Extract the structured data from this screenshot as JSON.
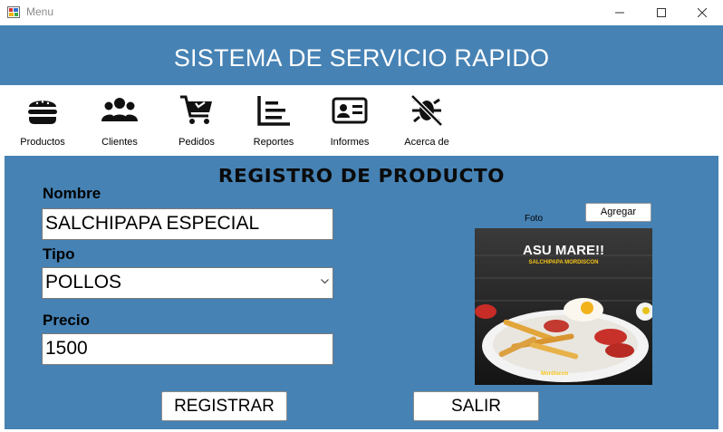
{
  "window": {
    "title": "Menu",
    "icons": [
      "app-icon",
      "minimize-icon",
      "maximize-icon",
      "close-icon"
    ]
  },
  "header": {
    "title": "SISTEMA DE SERVICIO RAPIDO",
    "background": "#4682b4"
  },
  "toolbar": {
    "items": [
      {
        "label": "Productos",
        "icon": "burger-icon"
      },
      {
        "label": "Clientes",
        "icon": "users-icon"
      },
      {
        "label": "Pedidos",
        "icon": "cart-icon"
      },
      {
        "label": "Reportes",
        "icon": "chart-icon"
      },
      {
        "label": "Informes",
        "icon": "id-card-icon"
      },
      {
        "label": "Acerca de",
        "icon": "bug-slash-icon"
      }
    ]
  },
  "form": {
    "title": "REGISTRO DE PRODUCTO",
    "nombre_label": "Nombre",
    "nombre_value": "SALCHIPAPA ESPECIAL",
    "tipo_label": "Tipo",
    "tipo_value": "POLLOS",
    "precio_label": "Precio",
    "precio_value": "1500",
    "foto_label": "Foto",
    "agregar_label": "Agregar",
    "photo_headline": "ASU MARE!!",
    "photo_subline": "SALCHIPAPA MORDISCON",
    "photo_logo": "Mordiscon",
    "registrar_label": "REGISTRAR",
    "salir_label": "SALIR"
  },
  "colors": {
    "accent": "#4682b4",
    "panel": "#4682b4",
    "text": "#000000"
  }
}
